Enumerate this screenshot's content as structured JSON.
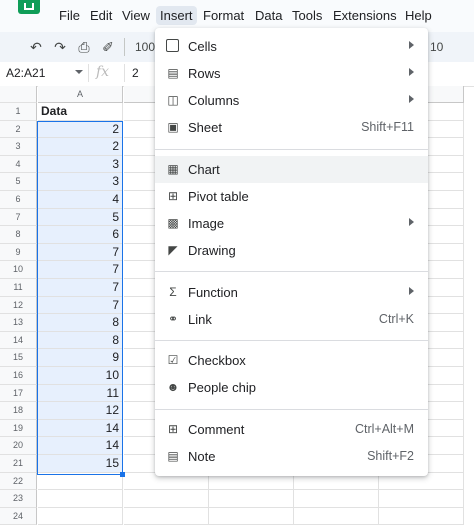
{
  "menubar": {
    "items": [
      "File",
      "Edit",
      "View",
      "Insert",
      "Format",
      "Data",
      "Tools",
      "Extensions",
      "Help"
    ]
  },
  "toolbar": {
    "zoom": "100",
    "font_size": "10"
  },
  "formula_bar": {
    "name_box": "A2:A21",
    "fx": "fx",
    "value": "2"
  },
  "grid": {
    "column_a": "A",
    "row_numbers": [
      "1",
      "2",
      "3",
      "4",
      "5",
      "6",
      "7",
      "8",
      "9",
      "10",
      "11",
      "12",
      "13",
      "14",
      "15",
      "16",
      "17",
      "18",
      "19",
      "20",
      "21",
      "22",
      "23",
      "24"
    ],
    "header": "Data",
    "values": [
      "2",
      "2",
      "3",
      "3",
      "4",
      "5",
      "6",
      "7",
      "7",
      "7",
      "7",
      "8",
      "8",
      "9",
      "10",
      "11",
      "12",
      "14",
      "14",
      "15"
    ]
  },
  "insert_menu": {
    "items": [
      {
        "label": "Cells",
        "shortcut": "",
        "submenu": true,
        "icon": "cells-icon"
      },
      {
        "label": "Rows",
        "shortcut": "",
        "submenu": true,
        "icon": "rows-icon"
      },
      {
        "label": "Columns",
        "shortcut": "",
        "submenu": true,
        "icon": "columns-icon"
      },
      {
        "label": "Sheet",
        "shortcut": "Shift+F11",
        "submenu": false,
        "icon": "sheet-icon"
      },
      {
        "label": "Chart",
        "shortcut": "",
        "submenu": false,
        "icon": "chart-icon"
      },
      {
        "label": "Pivot table",
        "shortcut": "",
        "submenu": false,
        "icon": "pivot-table-icon"
      },
      {
        "label": "Image",
        "shortcut": "",
        "submenu": true,
        "icon": "image-icon"
      },
      {
        "label": "Drawing",
        "shortcut": "",
        "submenu": false,
        "icon": "drawing-icon"
      },
      {
        "label": "Function",
        "shortcut": "",
        "submenu": true,
        "icon": "sigma-icon"
      },
      {
        "label": "Link",
        "shortcut": "Ctrl+K",
        "submenu": false,
        "icon": "link-icon"
      },
      {
        "label": "Checkbox",
        "shortcut": "",
        "submenu": false,
        "icon": "checkbox-icon"
      },
      {
        "label": "People chip",
        "shortcut": "",
        "submenu": false,
        "icon": "people-chip-icon"
      },
      {
        "label": "Comment",
        "shortcut": "Ctrl+Alt+M",
        "submenu": false,
        "icon": "comment-icon"
      },
      {
        "label": "Note",
        "shortcut": "Shift+F2",
        "submenu": false,
        "icon": "note-icon"
      }
    ]
  }
}
